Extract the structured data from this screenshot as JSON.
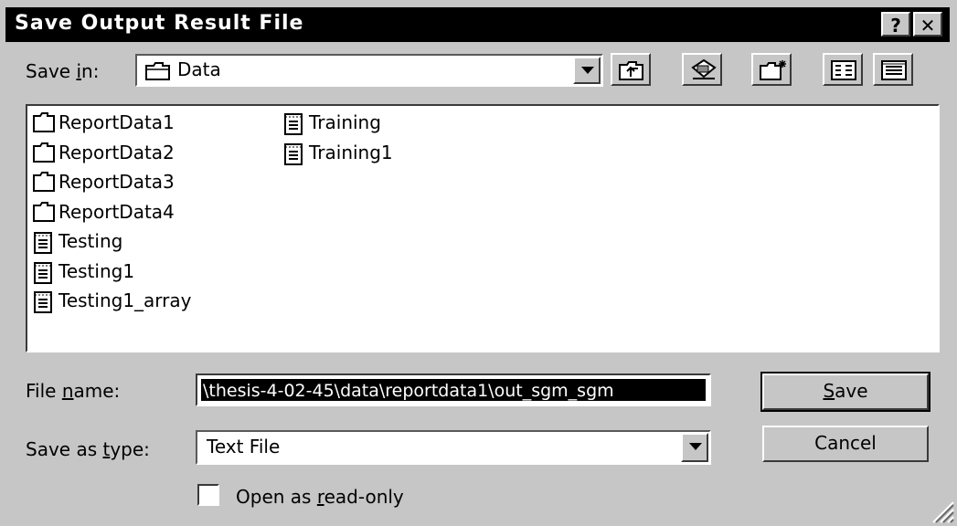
{
  "window": {
    "title": "Save Output Result File",
    "help_glyph": "?",
    "close_glyph": "✕"
  },
  "save_in": {
    "label_prefix": "Save ",
    "label_accel": "i",
    "label_suffix": "n:",
    "folder": "Data"
  },
  "toolbar": {
    "buttons": [
      "up-one-level-icon",
      "desktop-icon",
      "new-folder-icon",
      "list-view-icon",
      "details-view-icon"
    ]
  },
  "files": {
    "column1": [
      {
        "name": "ReportData1",
        "type": "folder"
      },
      {
        "name": "ReportData2",
        "type": "folder"
      },
      {
        "name": "ReportData3",
        "type": "folder"
      },
      {
        "name": "ReportData4",
        "type": "folder"
      },
      {
        "name": "Testing",
        "type": "text-file"
      },
      {
        "name": "Testing1",
        "type": "text-file"
      },
      {
        "name": "Testing1_array",
        "type": "text-file"
      }
    ],
    "column2": [
      {
        "name": "Training",
        "type": "text-file"
      },
      {
        "name": "Training1",
        "type": "text-file"
      }
    ]
  },
  "file_name": {
    "label_prefix": "File ",
    "label_accel": "n",
    "label_suffix": "ame:",
    "value": "\\thesis-4-02-45\\data\\reportdata1\\out_sgm_sgm"
  },
  "save_type": {
    "label_prefix": "Save as ",
    "label_accel": "t",
    "label_suffix": "ype:",
    "value": "Text File"
  },
  "buttons": {
    "save_accel": "S",
    "save_rest": "ave",
    "cancel": "Cancel"
  },
  "read_only": {
    "label_prefix": "Open as ",
    "label_accel": "r",
    "label_suffix": "ead-only",
    "checked": false
  },
  "colors": {
    "title_bar": "#000000",
    "dialog_bg": "#c6c6c6",
    "selection": "#000000"
  }
}
